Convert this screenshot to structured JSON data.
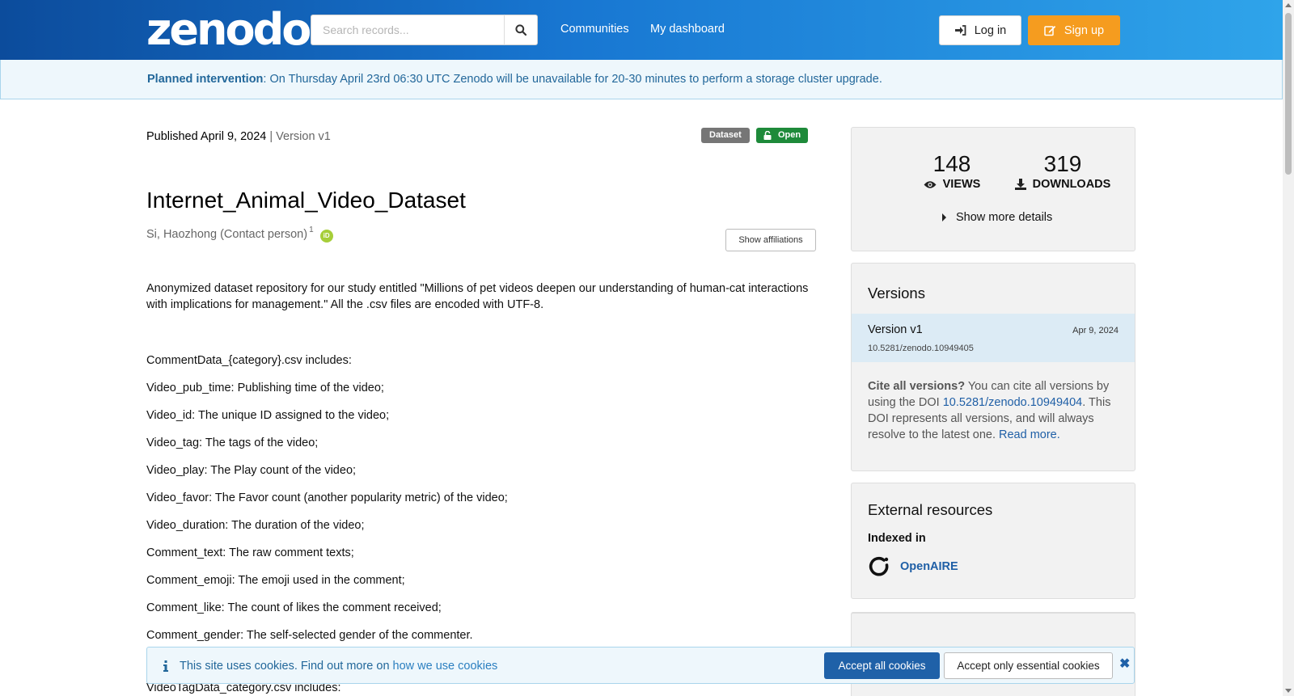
{
  "header": {
    "logo": "zenodo",
    "search_placeholder": "Search records...",
    "nav": [
      "Communities",
      "My dashboard"
    ],
    "login_label": "Log in",
    "signup_label": "Sign up",
    "colors": {
      "gradient_start": "#0c4c9c",
      "gradient_end": "#2fa4ea",
      "signup": "#f59c1f"
    }
  },
  "banner": {
    "bold": "Planned intervention",
    "text": ": On Thursday April 23rd 06:30 UTC Zenodo will be unavailable for 20-30 minutes to perform a storage cluster upgrade."
  },
  "record": {
    "published": "Published April 9, 2024",
    "version": "| Version v1",
    "badge_type": "Dataset",
    "badge_access": "Open",
    "title": "Internet_Animal_Video_Dataset",
    "creator": "Si, Haozhong (Contact person)",
    "creator_sup": "1",
    "orcid_label": "iD",
    "show_affiliations": "Show affiliations",
    "description": "Anonymized dataset repository for our study entitled \"Millions of pet videos deepen our understanding of human-cat interactions with implications for management.\" All the .csv files are encoded with UTF-8.",
    "fields": [
      "CommentData_{category}.csv includes:",
      "Video_pub_time: Publishing time of the video;",
      "Video_id: The unique ID assigned to the video;",
      "Video_tag: The tags of the video;",
      "Video_play: The Play count of the video;",
      "Video_favor: The Favor count (another popularity metric) of the video;",
      "Video_duration: The duration of the video;",
      "Comment_text: The raw comment texts;",
      "Comment_emoji: The emoji used in the comment;",
      "Comment_like: The count of likes the comment received;",
      "Comment_gender: The self-selected gender of the commenter."
    ],
    "next_line": "VideoTagData_category.csv includes:"
  },
  "stats": {
    "views": "148",
    "views_label": "VIEWS",
    "downloads": "319",
    "downloads_label": "DOWNLOADS",
    "more": "Show more details"
  },
  "versions": {
    "heading": "Versions",
    "item_name": "Version v1",
    "item_date": "Apr 9, 2024",
    "item_doi": "10.5281/zenodo.10949405",
    "cite_bold": "Cite all versions?",
    "cite_text1": " You can cite all versions by using the DOI ",
    "cite_doi": "10.5281/zenodo.10949404",
    "cite_text2": ". This DOI represents all versions, and will always resolve to the latest one. ",
    "read_more": "Read more."
  },
  "external": {
    "heading": "External resources",
    "indexed_label": "Indexed in",
    "source": "OpenAIRE"
  },
  "cookie": {
    "text": "This site uses cookies. Find out more on ",
    "link": "how we use cookies",
    "accept_all": "Accept all cookies",
    "accept_essential": "Accept only essential cookies"
  }
}
